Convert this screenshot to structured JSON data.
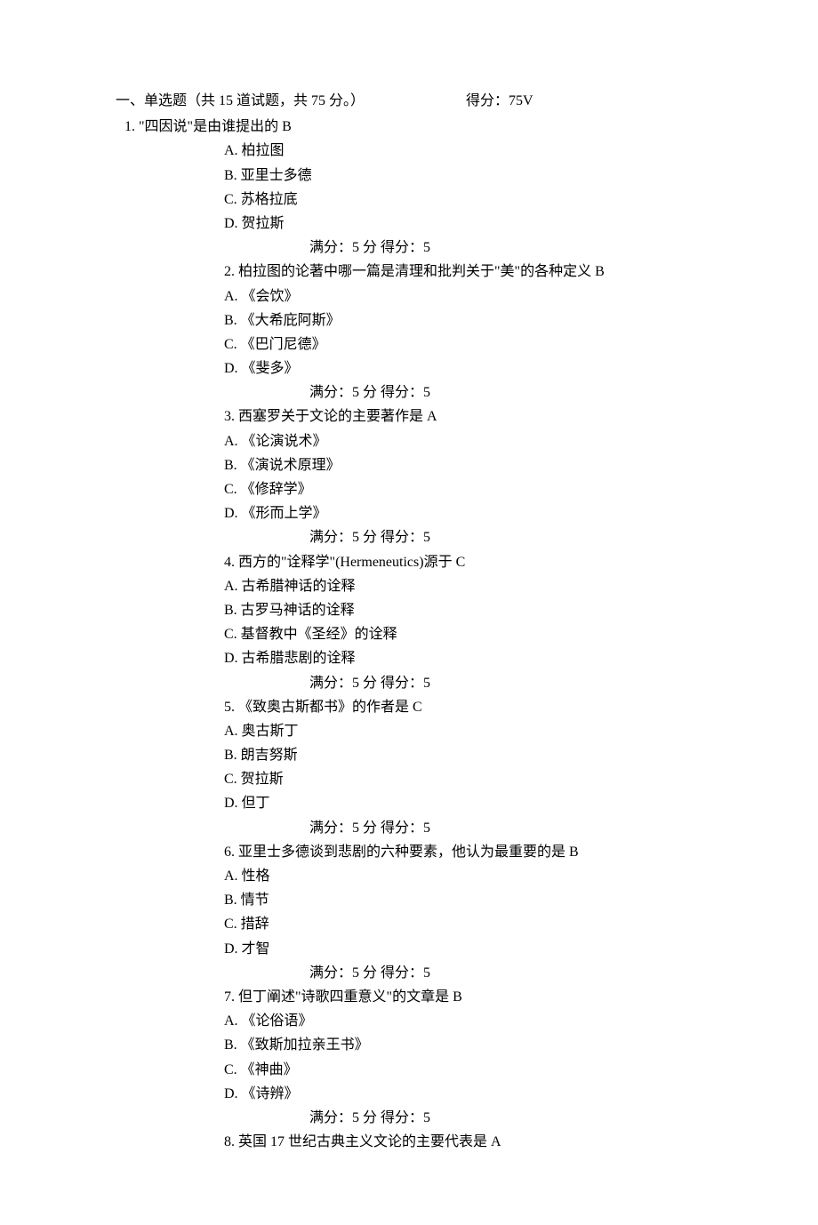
{
  "section": {
    "title": "一、单选题（共 15 道试题，共 75 分。）",
    "score_label": "得分：75V"
  },
  "score_line": "满分：5 分  得分：5",
  "q1": {
    "num": "1.",
    "text": "\"四因说\"是由谁提出的 B",
    "opts": {
      "A": "A.  柏拉图",
      "B": "B.  亚里士多德",
      "C": "C.  苏格拉底",
      "D": "D.  贺拉斯"
    }
  },
  "q2": {
    "line": "2.  柏拉图的论著中哪一篇是清理和批判关于\"美\"的各种定义 B",
    "opts": {
      "A": "A.  《会饮》",
      "B": "B.  《大希庇阿斯》",
      "C": "C.  《巴门尼德》",
      "D": "D.  《斐多》"
    }
  },
  "q3": {
    "line": "3.  西塞罗关于文论的主要著作是 A",
    "opts": {
      "A": "A.  《论演说术》",
      "B": "B.  《演说术原理》",
      "C": "C.  《修辞学》",
      "D": "D.  《形而上学》"
    }
  },
  "q4": {
    "line": "4.  西方的\"诠释学\"(Hermeneutics)源于 C",
    "opts": {
      "A": "A.  古希腊神话的诠释",
      "B": "B.  古罗马神话的诠释",
      "C": "C.  基督教中《圣经》的诠释",
      "D": "D.  古希腊悲剧的诠释"
    }
  },
  "q5": {
    "line": "5.  《致奥古斯都书》的作者是 C",
    "opts": {
      "A": "A.  奥古斯丁",
      "B": "B.  朗吉努斯",
      "C": "C.  贺拉斯",
      "D": "D.  但丁"
    }
  },
  "q6": {
    "line": "6.  亚里士多德谈到悲剧的六种要素，他认为最重要的是 B",
    "opts": {
      "A": "A.  性格",
      "B": "B.  情节",
      "C": "C.  措辞",
      "D": "D.  才智"
    }
  },
  "q7": {
    "line": "7.  但丁阐述\"诗歌四重意义\"的文章是 B",
    "opts": {
      "A": "A.  《论俗语》",
      "B": "B.  《致斯加拉亲王书》",
      "C": "C.  《神曲》",
      "D": "D.  《诗辨》"
    }
  },
  "q8": {
    "line": "8.  英国 17 世纪古典主义文论的主要代表是 A"
  }
}
